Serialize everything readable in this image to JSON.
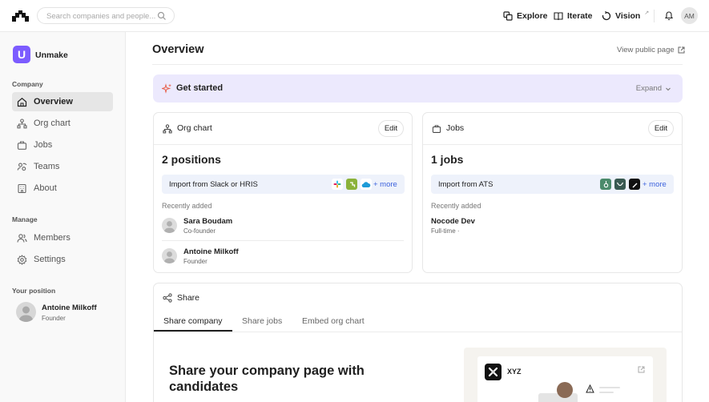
{
  "topbar": {
    "search_placeholder": "Search companies and people...",
    "nav": [
      {
        "label": "Explore",
        "icon": "explore-icon"
      },
      {
        "label": "Iterate",
        "icon": "iterate-icon"
      },
      {
        "label": "Vision",
        "icon": "vision-icon",
        "external_mark": "↗"
      }
    ],
    "user_initials": "AM"
  },
  "sidebar": {
    "company_logo_letter": "U",
    "company_name": "Unmake",
    "section_company": "Company",
    "company_items": [
      {
        "label": "Overview",
        "icon": "home-icon",
        "active": true
      },
      {
        "label": "Org chart",
        "icon": "org-chart-icon",
        "active": false
      },
      {
        "label": "Jobs",
        "icon": "briefcase-icon",
        "active": false
      },
      {
        "label": "Teams",
        "icon": "teams-icon",
        "active": false
      },
      {
        "label": "About",
        "icon": "building-icon",
        "active": false
      }
    ],
    "section_manage": "Manage",
    "manage_items": [
      {
        "label": "Members",
        "icon": "members-icon"
      },
      {
        "label": "Settings",
        "icon": "gear-icon"
      }
    ],
    "section_position": "Your position",
    "position": {
      "name": "Antoine Milkoff",
      "role": "Founder"
    }
  },
  "main": {
    "title": "Overview",
    "public_link": "View public page",
    "get_started": {
      "title": "Get started",
      "expand": "Expand"
    },
    "org_card": {
      "title": "Org chart",
      "edit": "Edit",
      "count": "2 positions",
      "import_label": "Import from Slack or HRIS",
      "more": "+ more",
      "recent_label": "Recently added",
      "people": [
        {
          "name": "Sara Boudam",
          "role": "Co-founder"
        },
        {
          "name": "Antoine Milkoff",
          "role": "Founder"
        }
      ]
    },
    "jobs_card": {
      "title": "Jobs",
      "edit": "Edit",
      "count": "1 jobs",
      "import_label": "Import from ATS",
      "more": "+ more",
      "recent_label": "Recently added",
      "jobs": [
        {
          "name": "Nocode Dev",
          "meta": "Full-time ·"
        }
      ]
    },
    "share": {
      "title": "Share",
      "tabs": [
        "Share company",
        "Share jobs",
        "Embed org chart"
      ],
      "active_tab": 0,
      "headline": "Share your company page with candidates",
      "preview_company": "XYZ"
    }
  },
  "colors": {
    "accent": "#7c5cff",
    "get_started_bg": "#ece9fd",
    "link": "#3d63dd",
    "sidebar_bg": "#f9f9f9"
  }
}
